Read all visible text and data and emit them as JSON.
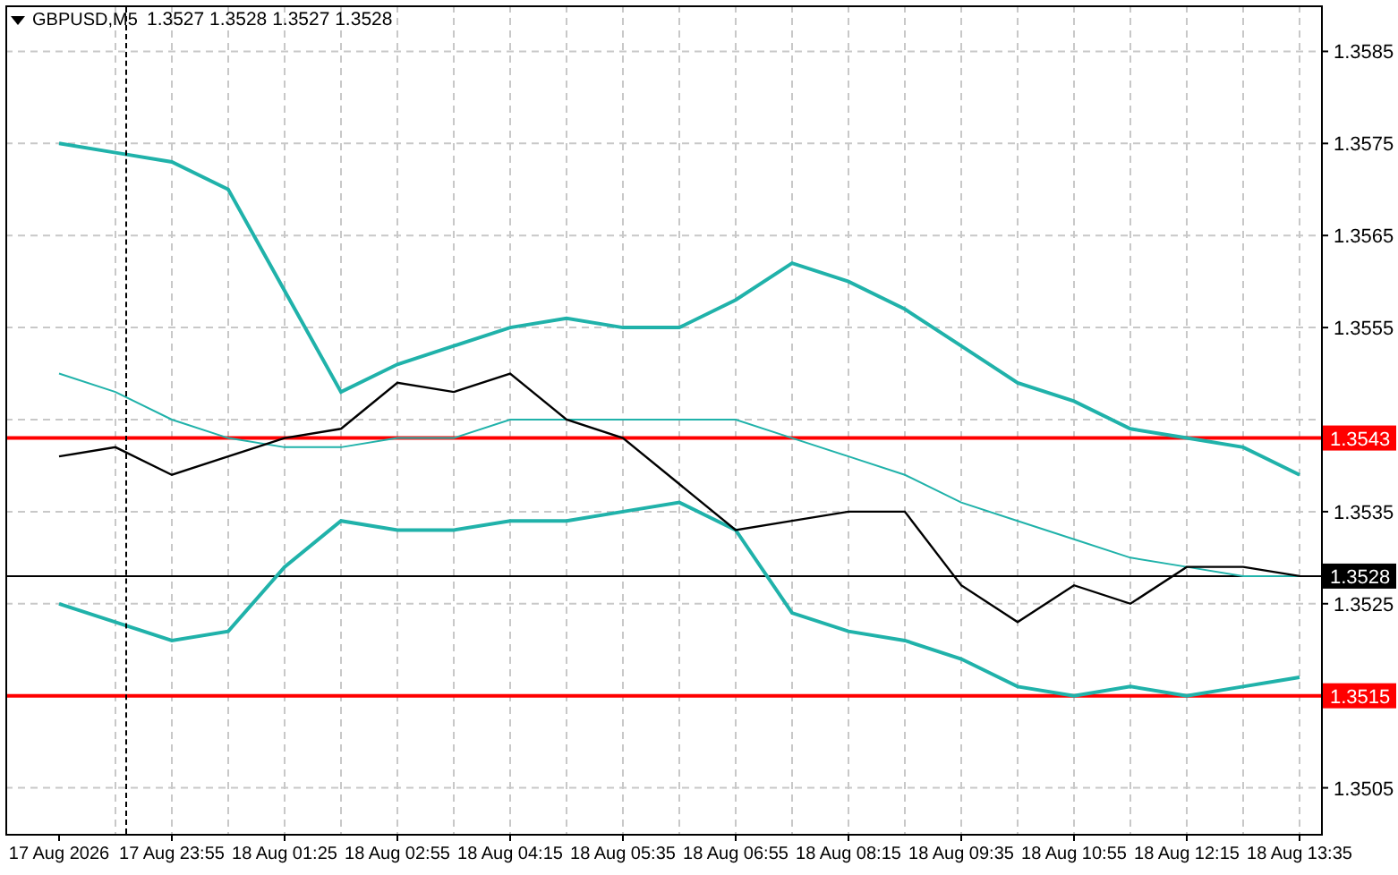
{
  "header": {
    "symbol": "GBPUSD,M5",
    "quote": "1.3527 1.3528 1.3527 1.3528"
  },
  "chart": {
    "chart_data": {
      "type": "line",
      "categories": [
        "17 Aug 2026",
        null,
        "17 Aug 23:55",
        null,
        "18 Aug 01:25",
        null,
        "18 Aug 02:55",
        null,
        "18 Aug 04:15",
        null,
        "18 Aug 05:35",
        null,
        "18 Aug 06:55",
        null,
        "18 Aug 08:15",
        null,
        "18 Aug 09:35",
        null,
        "18 Aug 10:55",
        null,
        "18 Aug 12:15",
        null,
        "18 Aug 13:35"
      ],
      "ylim": [
        1.35,
        1.359
      ],
      "yticks": [
        1.3505,
        1.3525,
        1.3535,
        1.3555,
        1.3565,
        1.3575,
        1.3585
      ],
      "series": [
        {
          "color": "#20b2aa",
          "values": [
            1.3575,
            1.3574,
            1.3573,
            1.357,
            1.3559,
            1.3548,
            1.3551,
            1.3553,
            1.3555,
            1.3556,
            1.3555,
            1.3555,
            1.3558,
            1.3562,
            1.356,
            1.3557,
            1.3553,
            1.3549,
            1.3547,
            1.3544,
            1.3543,
            1.3542,
            1.3539
          ]
        },
        {
          "color": "#20b2aa",
          "values": [
            1.355,
            1.3548,
            1.3545,
            1.3543,
            1.3542,
            1.3542,
            1.3543,
            1.3543,
            1.3545,
            1.3545,
            1.3545,
            1.3545,
            1.3545,
            1.3543,
            1.3541,
            1.3539,
            1.3536,
            1.3534,
            1.3532,
            1.353,
            1.3529,
            1.3528,
            1.3528
          ]
        },
        {
          "color": "#20b2aa",
          "values": [
            1.3525,
            1.3523,
            1.3521,
            1.3522,
            1.3529,
            1.3534,
            1.3533,
            1.3533,
            1.3534,
            1.3534,
            1.3535,
            1.3536,
            1.3533,
            1.3524,
            1.3522,
            1.3521,
            1.3519,
            1.3516,
            1.3515,
            1.3516,
            1.3515,
            1.3516,
            1.3517
          ]
        },
        {
          "color": "#000000",
          "values": [
            1.3541,
            1.3542,
            1.3539,
            1.3541,
            1.3543,
            1.3544,
            1.3549,
            1.3548,
            1.355,
            1.3545,
            1.3543,
            1.3538,
            1.3533,
            1.3534,
            1.3535,
            1.3535,
            1.3527,
            1.3523,
            1.3527,
            1.3525,
            1.3529,
            1.3529,
            1.3528
          ]
        }
      ],
      "grid": true,
      "ref_lines": [
        {
          "axis": "y",
          "value": 1.3543,
          "label": "1.3543",
          "color": "#ff0000"
        },
        {
          "axis": "y",
          "value": 1.3528,
          "label": "1.3528",
          "color": "#000000"
        },
        {
          "axis": "y",
          "value": 1.3515,
          "label": "1.3515",
          "color": "#ff0000"
        }
      ]
    }
  }
}
